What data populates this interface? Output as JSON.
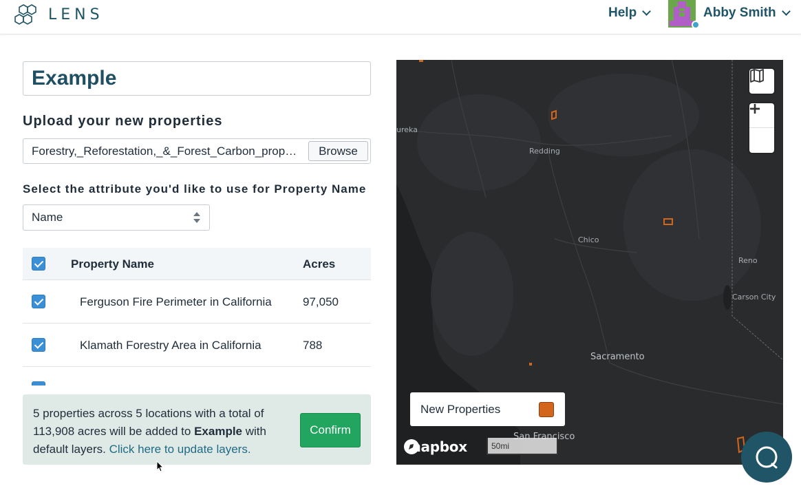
{
  "header": {
    "brand": "LENS",
    "help_label": "Help",
    "user_name": "Abby Smith"
  },
  "form": {
    "title_value": "Example",
    "upload_label": "Upload your new properties",
    "file_name": "Forestry,_Reforestation,_&_Forest_Carbon_properties.zip",
    "browse_label": "Browse",
    "attribute_label": "Select the attribute you'd like to use for Property Name",
    "attribute_selected": "Name"
  },
  "table": {
    "headers": {
      "name": "Property Name",
      "acres": "Acres"
    },
    "rows": [
      {
        "name": "Ferguson Fire Perimeter in California",
        "acres": "97,050"
      },
      {
        "name": "Klamath Forestry Area in California",
        "acres": "788"
      }
    ]
  },
  "summary": {
    "text_prefix": "5 properties across 5 locations with a total of 113,908 acres will be added to ",
    "project_name": "Example",
    "text_suffix": " with default layers. ",
    "link_label": "Click here to update layers.",
    "confirm_label": "Confirm"
  },
  "map": {
    "labels": {
      "eureka": "ureka",
      "redding": "Redding",
      "chico": "Chico",
      "reno": "Reno",
      "carson_city": "Carson City",
      "sacramento": "Sacramento",
      "san_francisco": "San Francisco"
    },
    "legend_label": "New Properties",
    "legend_color": "#d2661c",
    "mapbox_label": "mapbox",
    "scale_label": "50mi"
  },
  "colors": {
    "brand": "#1f5566",
    "confirm": "#22a65f",
    "checkbox": "#3a8fd6"
  }
}
